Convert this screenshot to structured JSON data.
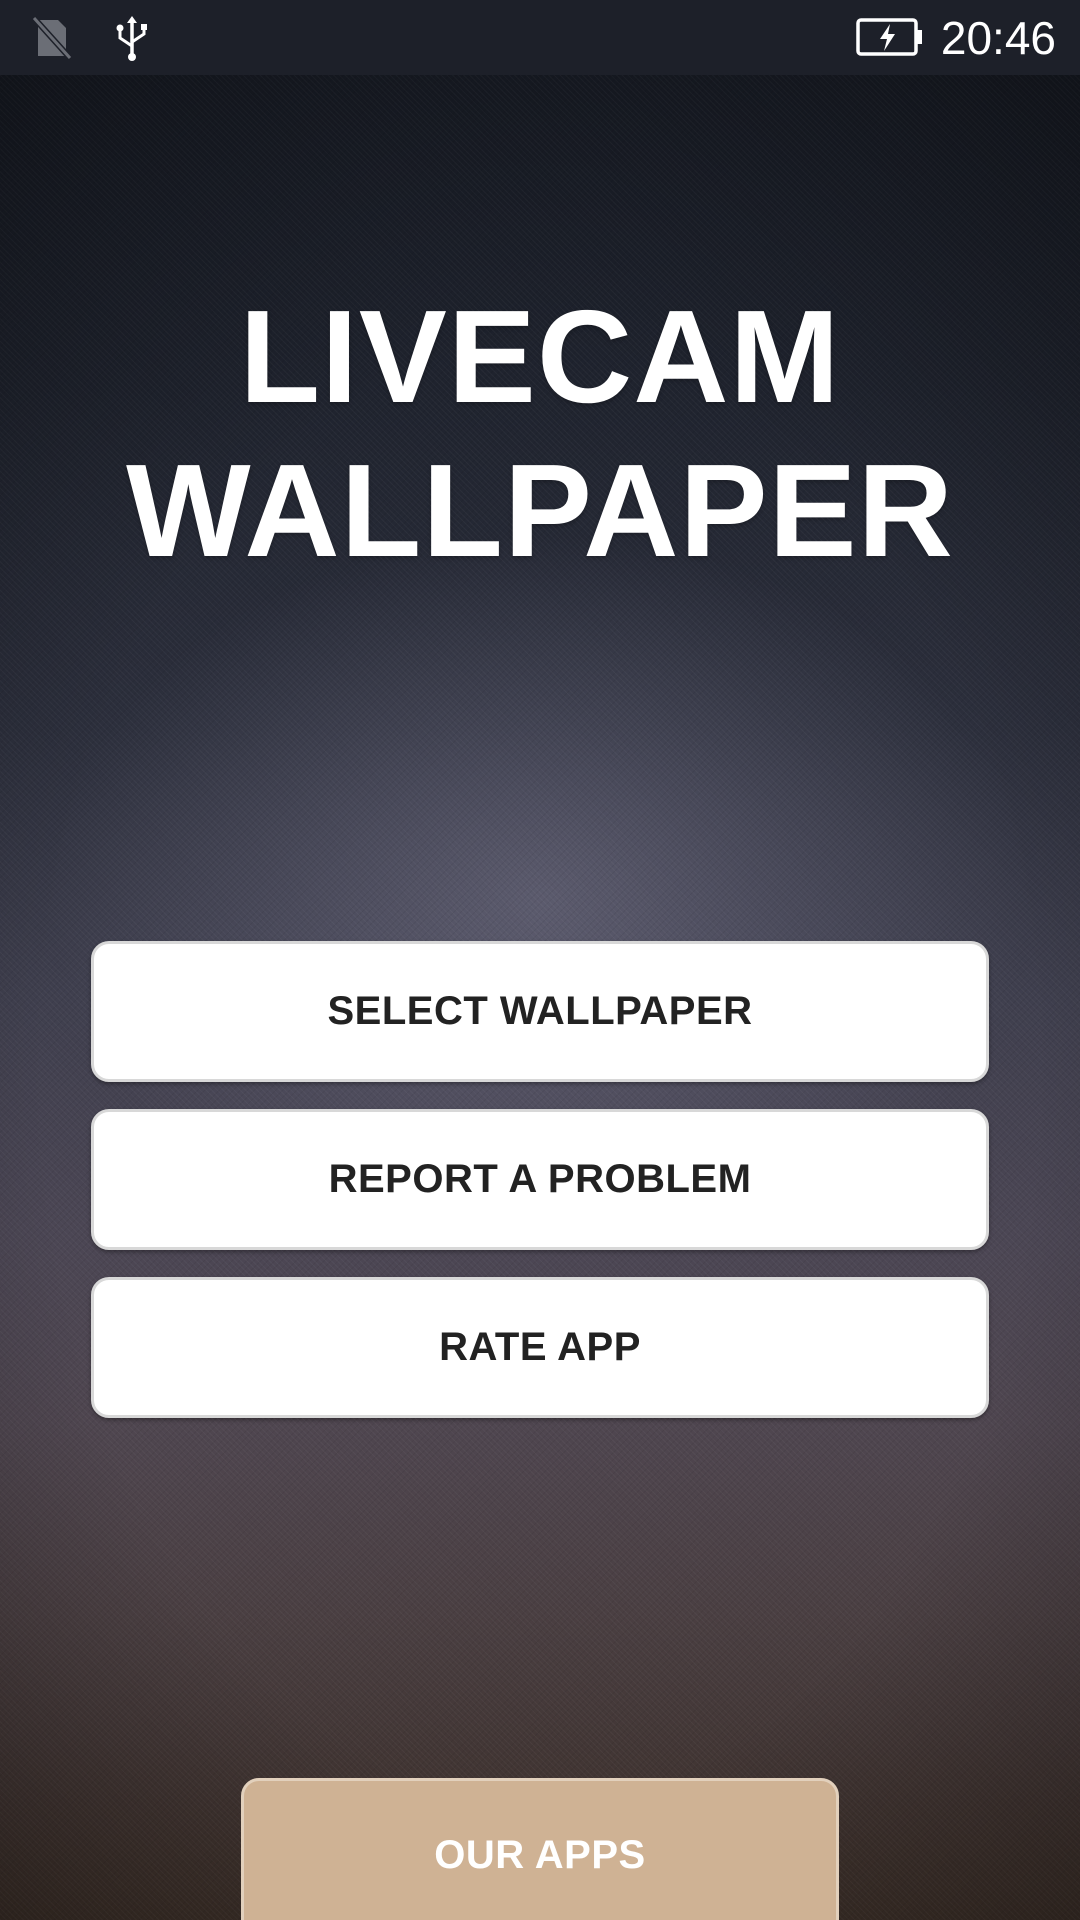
{
  "status_bar": {
    "time": "20:46",
    "icons": [
      "no-sim-icon",
      "usb-icon",
      "battery-charging-icon"
    ]
  },
  "title": {
    "line1": "LIVECAM",
    "line2": "WALLPAPER"
  },
  "menu": {
    "select_wallpaper": "SELECT WALLPAPER",
    "report_problem": "REPORT A PROBLEM",
    "rate_app": "RATE APP"
  },
  "footer": {
    "our_apps": "OUR APPS"
  },
  "colors": {
    "status_bar_bg": "#1d2029",
    "button_bg": "#ffffff",
    "button_text": "#222222",
    "our_apps_bg": "#cfb294",
    "title_text": "#ffffff"
  }
}
